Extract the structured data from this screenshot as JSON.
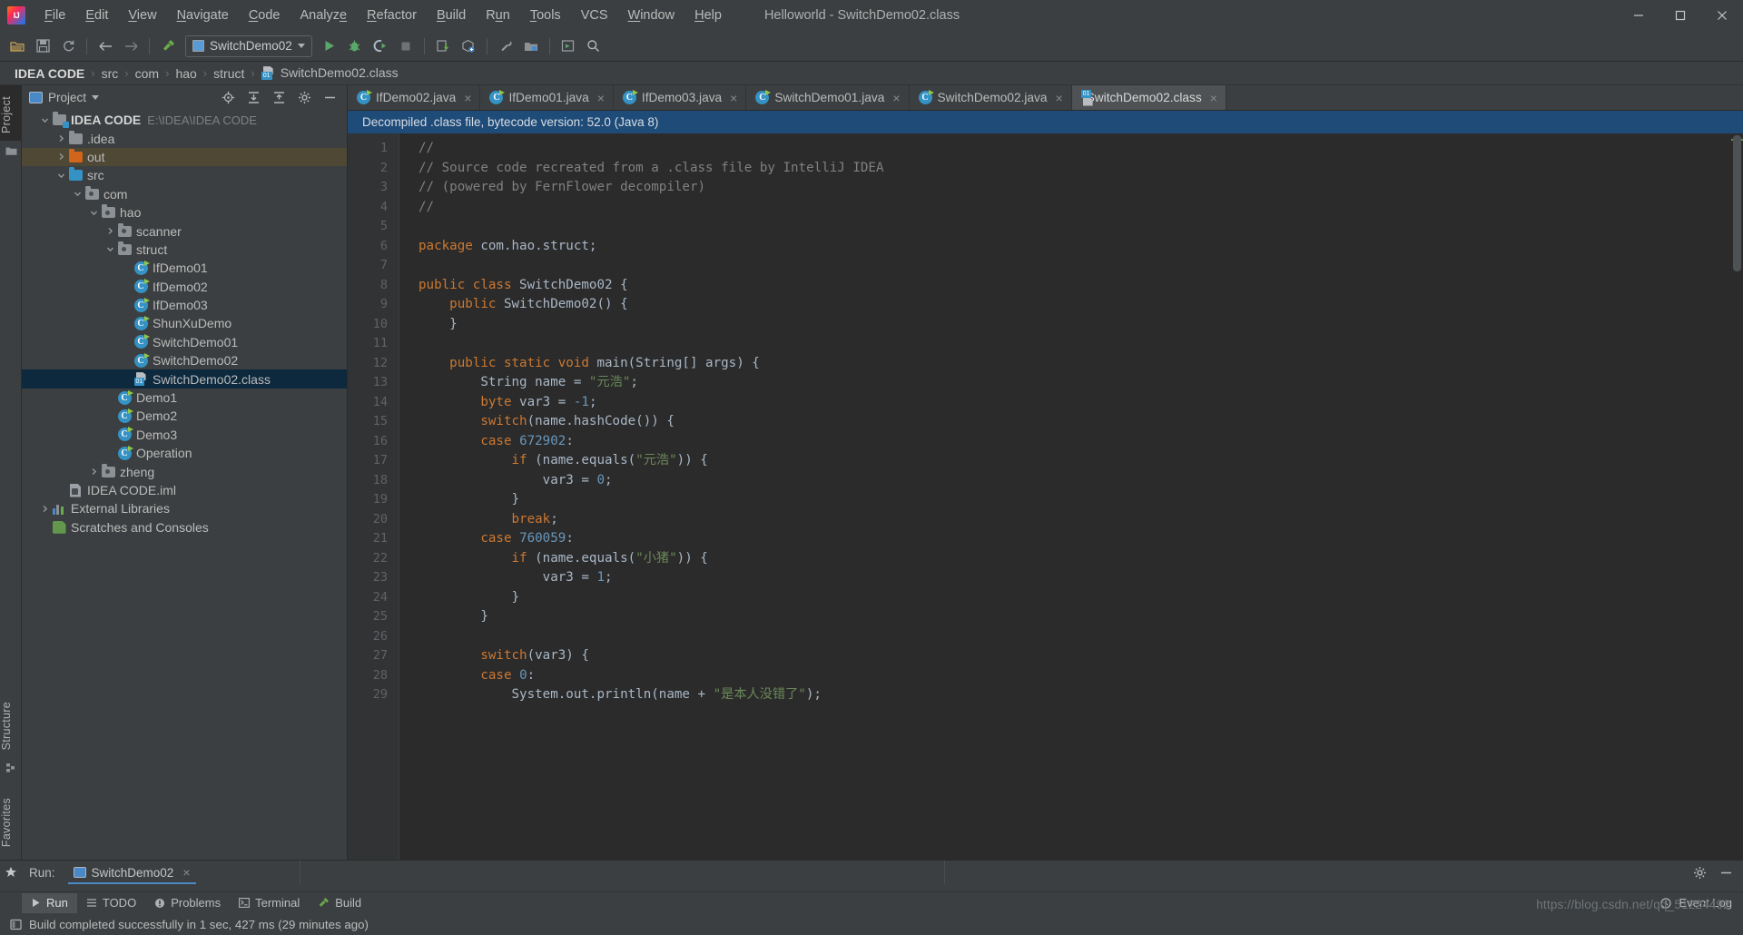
{
  "titlebar": {
    "logo_icon": "intellij-logo-icon",
    "window_title": "Helloworld - SwitchDemo02.class",
    "menus": [
      {
        "label": "File"
      },
      {
        "label": "Edit"
      },
      {
        "label": "View"
      },
      {
        "label": "Navigate"
      },
      {
        "label": "Code"
      },
      {
        "label": "Analyze"
      },
      {
        "label": "Refactor"
      },
      {
        "label": "Build"
      },
      {
        "label": "Run"
      },
      {
        "label": "Tools"
      },
      {
        "label": "VCS"
      },
      {
        "label": "Window"
      },
      {
        "label": "Help"
      }
    ],
    "controls": [
      "minimize",
      "maximize",
      "close"
    ]
  },
  "toolbar": {
    "run_config_label": "SwitchDemo02",
    "buttons": [
      "open-folder-icon",
      "save-all-icon",
      "sync-refresh-icon",
      "back-icon",
      "forward-icon",
      "build-hammer-icon",
      "run-icon",
      "debug-icon",
      "run-coverage-icon",
      "stop-icon",
      "update-project-icon",
      "commit-icon",
      "settings-wrench-icon",
      "project-structure-icon",
      "select-opened-file-icon",
      "search-everywhere-icon"
    ]
  },
  "breadcrumb": {
    "items": [
      {
        "label": "IDEA CODE",
        "icon": ""
      },
      {
        "label": "src",
        "icon": ""
      },
      {
        "label": "com",
        "icon": ""
      },
      {
        "label": "hao",
        "icon": ""
      },
      {
        "label": "struct",
        "icon": ""
      },
      {
        "label": "SwitchDemo02.class",
        "icon": "class-file-icon"
      }
    ],
    "separator": "›"
  },
  "left_rail": {
    "top_label": "Project",
    "bottom_labels": [
      "Structure",
      "Favorites"
    ]
  },
  "project_panel": {
    "title": "Project",
    "actions": [
      "locate-icon",
      "expand-all-icon",
      "collapse-all-icon",
      "gear-icon",
      "hide-icon"
    ],
    "tree": [
      {
        "depth": 0,
        "arrow": "down",
        "icon": "project-folder-icon",
        "label": "IDEA CODE",
        "sub": "E:\\IDEA\\IDEA CODE",
        "bold": true,
        "state": "normal"
      },
      {
        "depth": 1,
        "arrow": "right",
        "icon": "folder-gray-icon",
        "label": ".idea",
        "sub": "",
        "bold": false,
        "state": "normal"
      },
      {
        "depth": 1,
        "arrow": "right",
        "icon": "folder-orange-icon",
        "label": "out",
        "sub": "",
        "bold": false,
        "state": "highlight"
      },
      {
        "depth": 1,
        "arrow": "down",
        "icon": "folder-blue-icon",
        "label": "src",
        "sub": "",
        "bold": false,
        "state": "normal"
      },
      {
        "depth": 2,
        "arrow": "down",
        "icon": "package-icon",
        "label": "com",
        "sub": "",
        "bold": false,
        "state": "normal"
      },
      {
        "depth": 3,
        "arrow": "down",
        "icon": "package-icon",
        "label": "hao",
        "sub": "",
        "bold": false,
        "state": "normal"
      },
      {
        "depth": 4,
        "arrow": "right",
        "icon": "package-icon",
        "label": "scanner",
        "sub": "",
        "bold": false,
        "state": "normal"
      },
      {
        "depth": 4,
        "arrow": "down",
        "icon": "package-icon",
        "label": "struct",
        "sub": "",
        "bold": false,
        "state": "normal"
      },
      {
        "depth": 5,
        "arrow": "none",
        "icon": "java-class-icon",
        "label": "IfDemo01",
        "sub": "",
        "bold": false,
        "state": "normal"
      },
      {
        "depth": 5,
        "arrow": "none",
        "icon": "java-class-icon",
        "label": "IfDemo02",
        "sub": "",
        "bold": false,
        "state": "normal"
      },
      {
        "depth": 5,
        "arrow": "none",
        "icon": "java-class-icon",
        "label": "IfDemo03",
        "sub": "",
        "bold": false,
        "state": "normal"
      },
      {
        "depth": 5,
        "arrow": "none",
        "icon": "java-class-icon",
        "label": "ShunXuDemo",
        "sub": "",
        "bold": false,
        "state": "normal"
      },
      {
        "depth": 5,
        "arrow": "none",
        "icon": "java-class-icon",
        "label": "SwitchDemo01",
        "sub": "",
        "bold": false,
        "state": "normal"
      },
      {
        "depth": 5,
        "arrow": "none",
        "icon": "java-class-icon",
        "label": "SwitchDemo02",
        "sub": "",
        "bold": false,
        "state": "normal"
      },
      {
        "depth": 5,
        "arrow": "none",
        "icon": "class-file-icon",
        "label": "SwitchDemo02.class",
        "sub": "",
        "bold": false,
        "state": "selected"
      },
      {
        "depth": 4,
        "arrow": "none",
        "icon": "java-class-icon",
        "label": "Demo1",
        "sub": "",
        "bold": false,
        "state": "normal"
      },
      {
        "depth": 4,
        "arrow": "none",
        "icon": "java-class-icon",
        "label": "Demo2",
        "sub": "",
        "bold": false,
        "state": "normal"
      },
      {
        "depth": 4,
        "arrow": "none",
        "icon": "java-class-icon",
        "label": "Demo3",
        "sub": "",
        "bold": false,
        "state": "normal"
      },
      {
        "depth": 4,
        "arrow": "none",
        "icon": "java-class-icon",
        "label": "Operation",
        "sub": "",
        "bold": false,
        "state": "normal"
      },
      {
        "depth": 3,
        "arrow": "right",
        "icon": "package-icon",
        "label": "zheng",
        "sub": "",
        "bold": false,
        "state": "normal"
      },
      {
        "depth": 1,
        "arrow": "none",
        "icon": "iml-file-icon",
        "label": "IDEA CODE.iml",
        "sub": "",
        "bold": false,
        "state": "normal"
      },
      {
        "depth": 0,
        "arrow": "right",
        "icon": "external-libraries-icon",
        "label": "External Libraries",
        "sub": "",
        "bold": false,
        "state": "normal"
      },
      {
        "depth": 0,
        "arrow": "none",
        "icon": "scratches-icon",
        "label": "Scratches and Consoles",
        "sub": "",
        "bold": false,
        "state": "normal"
      }
    ]
  },
  "editor": {
    "tabs": [
      {
        "label": "IfDemo02.java",
        "icon": "java-class-icon",
        "active": false
      },
      {
        "label": "IfDemo01.java",
        "icon": "java-class-icon",
        "active": false
      },
      {
        "label": "IfDemo03.java",
        "icon": "java-class-icon",
        "active": false
      },
      {
        "label": "SwitchDemo01.java",
        "icon": "java-class-icon",
        "active": false
      },
      {
        "label": "SwitchDemo02.java",
        "icon": "java-class-icon",
        "active": false
      },
      {
        "label": "SwitchDemo02.class",
        "icon": "class-file-icon",
        "active": true
      }
    ],
    "close_glyph": "×",
    "notice": "Decompiled .class file, bytecode version: 52.0 (Java 8)",
    "first_line_number": 1,
    "lines": [
      {
        "n": 1,
        "tokens": [
          {
            "t": "//",
            "c": "cm"
          }
        ]
      },
      {
        "n": 2,
        "tokens": [
          {
            "t": "// Source code recreated from a .class file by IntelliJ IDEA",
            "c": "cm"
          }
        ]
      },
      {
        "n": 3,
        "tokens": [
          {
            "t": "// (powered by FernFlower decompiler)",
            "c": "cm"
          }
        ]
      },
      {
        "n": 4,
        "tokens": [
          {
            "t": "//",
            "c": "cm"
          }
        ]
      },
      {
        "n": 5,
        "tokens": []
      },
      {
        "n": 6,
        "tokens": [
          {
            "t": "package",
            "c": "kw"
          },
          {
            "t": " com.hao.struct;",
            "c": "pl"
          }
        ]
      },
      {
        "n": 7,
        "tokens": []
      },
      {
        "n": 8,
        "tokens": [
          {
            "t": "public class",
            "c": "kw"
          },
          {
            "t": " SwitchDemo02 {",
            "c": "pl"
          }
        ]
      },
      {
        "n": 9,
        "tokens": [
          {
            "t": "    ",
            "c": "pl"
          },
          {
            "t": "public",
            "c": "kw"
          },
          {
            "t": " SwitchDemo02() {",
            "c": "pl"
          }
        ]
      },
      {
        "n": 10,
        "tokens": [
          {
            "t": "    }",
            "c": "pl"
          }
        ]
      },
      {
        "n": 11,
        "tokens": []
      },
      {
        "n": 12,
        "tokens": [
          {
            "t": "    ",
            "c": "pl"
          },
          {
            "t": "public static void",
            "c": "kw"
          },
          {
            "t": " main(String[] args) {",
            "c": "pl"
          }
        ]
      },
      {
        "n": 13,
        "tokens": [
          {
            "t": "        String name = ",
            "c": "pl"
          },
          {
            "t": "\"元浩\"",
            "c": "st"
          },
          {
            "t": ";",
            "c": "pl"
          }
        ]
      },
      {
        "n": 14,
        "tokens": [
          {
            "t": "        ",
            "c": "pl"
          },
          {
            "t": "byte",
            "c": "kw"
          },
          {
            "t": " var3 = ",
            "c": "pl"
          },
          {
            "t": "-1",
            "c": "nu"
          },
          {
            "t": ";",
            "c": "pl"
          }
        ]
      },
      {
        "n": 15,
        "tokens": [
          {
            "t": "        ",
            "c": "pl"
          },
          {
            "t": "switch",
            "c": "kw"
          },
          {
            "t": "(name.hashCode()) {",
            "c": "pl"
          }
        ]
      },
      {
        "n": 16,
        "tokens": [
          {
            "t": "        ",
            "c": "pl"
          },
          {
            "t": "case",
            "c": "kw"
          },
          {
            "t": " ",
            "c": "pl"
          },
          {
            "t": "672902",
            "c": "nu"
          },
          {
            "t": ":",
            "c": "pl"
          }
        ]
      },
      {
        "n": 17,
        "tokens": [
          {
            "t": "            ",
            "c": "pl"
          },
          {
            "t": "if",
            "c": "kw"
          },
          {
            "t": " (name.equals(",
            "c": "pl"
          },
          {
            "t": "\"元浩\"",
            "c": "st"
          },
          {
            "t": ")) {",
            "c": "pl"
          }
        ]
      },
      {
        "n": 18,
        "tokens": [
          {
            "t": "                var3 = ",
            "c": "pl"
          },
          {
            "t": "0",
            "c": "nu"
          },
          {
            "t": ";",
            "c": "pl"
          }
        ]
      },
      {
        "n": 19,
        "tokens": [
          {
            "t": "            }",
            "c": "pl"
          }
        ]
      },
      {
        "n": 20,
        "tokens": [
          {
            "t": "            ",
            "c": "pl"
          },
          {
            "t": "break",
            "c": "kw"
          },
          {
            "t": ";",
            "c": "pl"
          }
        ]
      },
      {
        "n": 21,
        "tokens": [
          {
            "t": "        ",
            "c": "pl"
          },
          {
            "t": "case",
            "c": "kw"
          },
          {
            "t": " ",
            "c": "pl"
          },
          {
            "t": "760059",
            "c": "nu"
          },
          {
            "t": ":",
            "c": "pl"
          }
        ]
      },
      {
        "n": 22,
        "tokens": [
          {
            "t": "            ",
            "c": "pl"
          },
          {
            "t": "if",
            "c": "kw"
          },
          {
            "t": " (name.equals(",
            "c": "pl"
          },
          {
            "t": "\"小猪\"",
            "c": "st"
          },
          {
            "t": ")) {",
            "c": "pl"
          }
        ]
      },
      {
        "n": 23,
        "tokens": [
          {
            "t": "                var3 = ",
            "c": "pl"
          },
          {
            "t": "1",
            "c": "nu"
          },
          {
            "t": ";",
            "c": "pl"
          }
        ]
      },
      {
        "n": 24,
        "tokens": [
          {
            "t": "            }",
            "c": "pl"
          }
        ]
      },
      {
        "n": 25,
        "tokens": [
          {
            "t": "        }",
            "c": "pl"
          }
        ]
      },
      {
        "n": 26,
        "tokens": []
      },
      {
        "n": 27,
        "tokens": [
          {
            "t": "        ",
            "c": "pl"
          },
          {
            "t": "switch",
            "c": "kw"
          },
          {
            "t": "(var3) {",
            "c": "pl"
          }
        ]
      },
      {
        "n": 28,
        "tokens": [
          {
            "t": "        ",
            "c": "pl"
          },
          {
            "t": "case",
            "c": "kw"
          },
          {
            "t": " ",
            "c": "pl"
          },
          {
            "t": "0",
            "c": "nu"
          },
          {
            "t": ":",
            "c": "pl"
          }
        ]
      },
      {
        "n": 29,
        "tokens": [
          {
            "t": "            System.out.println(name + ",
            "c": "pl"
          },
          {
            "t": "\"是本人没错了\"",
            "c": "st"
          },
          {
            "t": ");",
            "c": "pl"
          }
        ]
      }
    ]
  },
  "run_panel": {
    "star_icon": "favorites-star-icon",
    "label": "Run:",
    "tab_label": "SwitchDemo02",
    "tab_icon": "run-config-icon",
    "close_glyph": "×",
    "right_icons": [
      "gear-icon",
      "hide-icon"
    ]
  },
  "toolwindow_bar": {
    "items": [
      {
        "label": "Run",
        "icon": "run-triangle-icon",
        "active": true
      },
      {
        "label": "TODO",
        "icon": "todo-list-icon",
        "active": false
      },
      {
        "label": "Problems",
        "icon": "problems-icon",
        "active": false
      },
      {
        "label": "Terminal",
        "icon": "terminal-icon",
        "active": false
      },
      {
        "label": "Build",
        "icon": "build-hammer-icon",
        "active": false
      }
    ],
    "event_log": "Event Log",
    "event_log_icon": "event-log-icon"
  },
  "statusbar": {
    "icon": "status-message-icon",
    "message": "Build completed successfully in 1 sec, 427 ms (29 minutes ago)",
    "watermark": "https://blog.csdn.net/qq_51224492"
  },
  "colors": {
    "accent_blue": "#4a88c7",
    "panel_bg": "#3c3f41",
    "editor_bg": "#2b2b2b",
    "selection_blue": "#0d293e",
    "highlight_brown": "#4e4834",
    "notice_blue": "#1f4b78",
    "comment_gray": "#808080",
    "keyword_orange": "#cc7832",
    "string_green": "#6a8759",
    "number_blue": "#6897bb"
  }
}
